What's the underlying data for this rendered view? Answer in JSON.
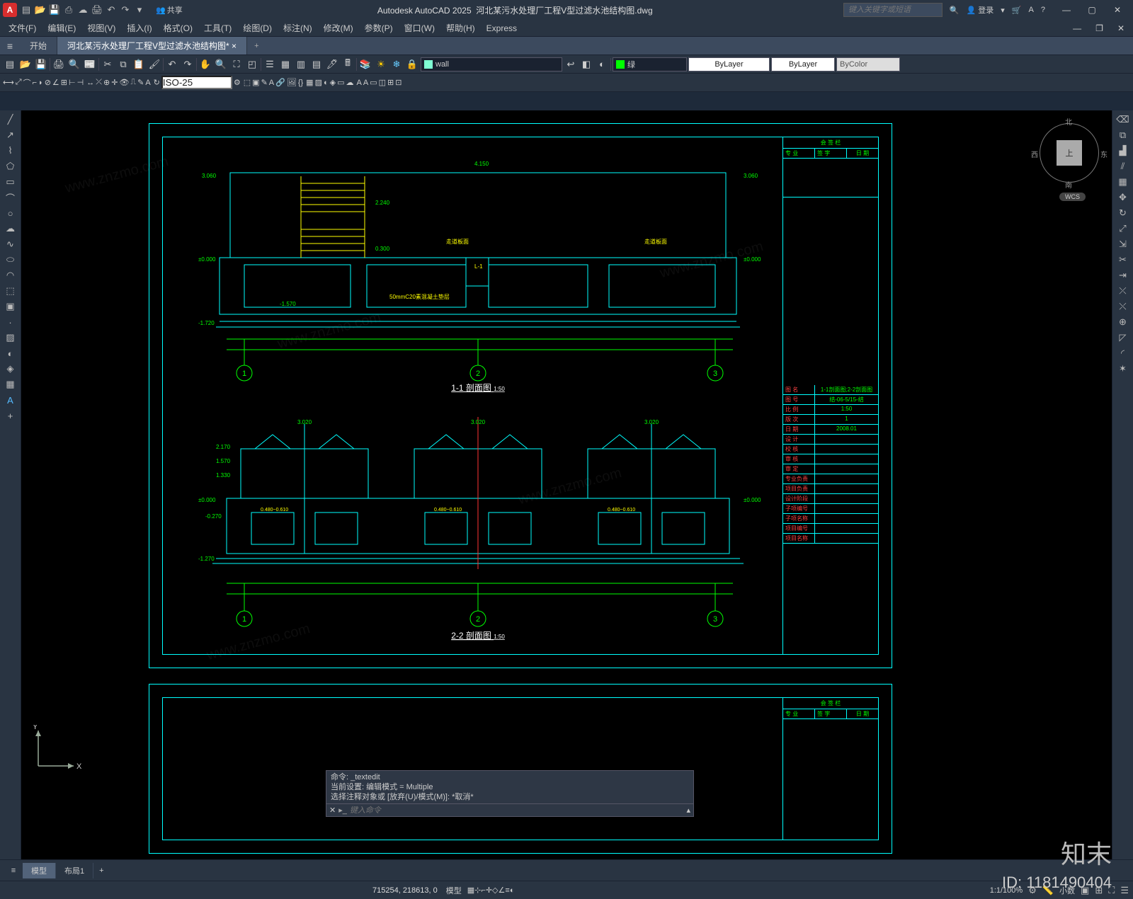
{
  "app": {
    "logo": "A",
    "name": "Autodesk AutoCAD 2025",
    "file": "河北某污水处理厂工程V型过滤水池结构图.dwg",
    "search_ph": "键入关键字或短语",
    "login": "登录",
    "share": "共享"
  },
  "menus": [
    "文件(F)",
    "编辑(E)",
    "视图(V)",
    "插入(I)",
    "格式(O)",
    "工具(T)",
    "绘图(D)",
    "标注(N)",
    "修改(M)",
    "参数(P)",
    "窗口(W)",
    "帮助(H)",
    "Express"
  ],
  "tabs": {
    "start": "开始",
    "doc": "河北某污水处理厂工程V型过滤水池结构图*"
  },
  "layer": {
    "name": "wall",
    "color": "#7fffd4",
    "current": "绿",
    "bylayer": "ByLayer",
    "bycolor": "ByColor"
  },
  "dimstyle": "ISO-25",
  "viewcube": {
    "face": "上",
    "n": "北",
    "s": "南",
    "e": "东",
    "w": "西",
    "wcs": "WCS"
  },
  "drawing": {
    "sec1": {
      "title": "1-1 剖面图",
      "scale": "1:50",
      "dims": {
        "top": "4.150",
        "left_el1": "3.060",
        "left_el2": "±0.000",
        "bottom_el": "-1.720",
        "d1": "-1.570",
        "h1": "2.240",
        "h2": "0.300",
        "note": "50mmC20素混凝土垫层",
        "beam": "L-1",
        "label1": "走道板面",
        "right_el": "3.060",
        "right_el2": "±0.000",
        "s1": "-1.720"
      },
      "grids": [
        "1",
        "2",
        "3"
      ]
    },
    "sec2": {
      "title": "2-2 剖面图",
      "scale": "1:50",
      "dims": {
        "top": "3.020",
        "el1": "2.170",
        "el2": "1.570",
        "el3": "1.330",
        "el4": "±0.000",
        "el5": "-0.270",
        "bl": "-1.270",
        "w1": "0.480~0.610",
        "right": "±0.000"
      },
      "grids": [
        "1",
        "2",
        "3"
      ]
    }
  },
  "titleblock": {
    "revhead": [
      "专 业",
      "签 字",
      "日 期"
    ],
    "header": "会 签 栏",
    "rows": [
      {
        "k": "图  名",
        "v": "1-1剖面图;2-2剖面图"
      },
      {
        "k": "图  号",
        "v": "结-06-5/15-结"
      },
      {
        "k": "比  例",
        "v": "1:50"
      },
      {
        "k": "版  次",
        "v": "1"
      },
      {
        "k": "日  期",
        "v": "2008.01"
      },
      {
        "k": "设  计",
        "v": ""
      },
      {
        "k": "校  核",
        "v": ""
      },
      {
        "k": "审  核",
        "v": ""
      },
      {
        "k": "审  定",
        "v": ""
      },
      {
        "k": "专业负责",
        "v": ""
      },
      {
        "k": "项目负责",
        "v": ""
      },
      {
        "k": "设计阶段",
        "v": ""
      },
      {
        "k": "子项编号",
        "v": ""
      },
      {
        "k": "子项名称",
        "v": ""
      },
      {
        "k": "项目编号",
        "v": ""
      },
      {
        "k": "项目名称",
        "v": ""
      }
    ]
  },
  "cmd": {
    "h1": "命令: _textedit",
    "h2": "当前设置: 编辑模式 = Multiple",
    "h3": "选择注释对象或 [放弃(U)/模式(M)]: *取消*",
    "ph": "键入命令"
  },
  "modeltabs": {
    "model": "模型",
    "layout": "布局1"
  },
  "status": {
    "coords": "715254, 218613, 0",
    "model": "模型",
    "scale": "1:1/100%",
    "dec": "小数"
  },
  "watermark": "www.znzmo.com",
  "brand": "知末",
  "id": "ID: 1181490404",
  "ucs": {
    "x": "X",
    "y": "Y"
  }
}
